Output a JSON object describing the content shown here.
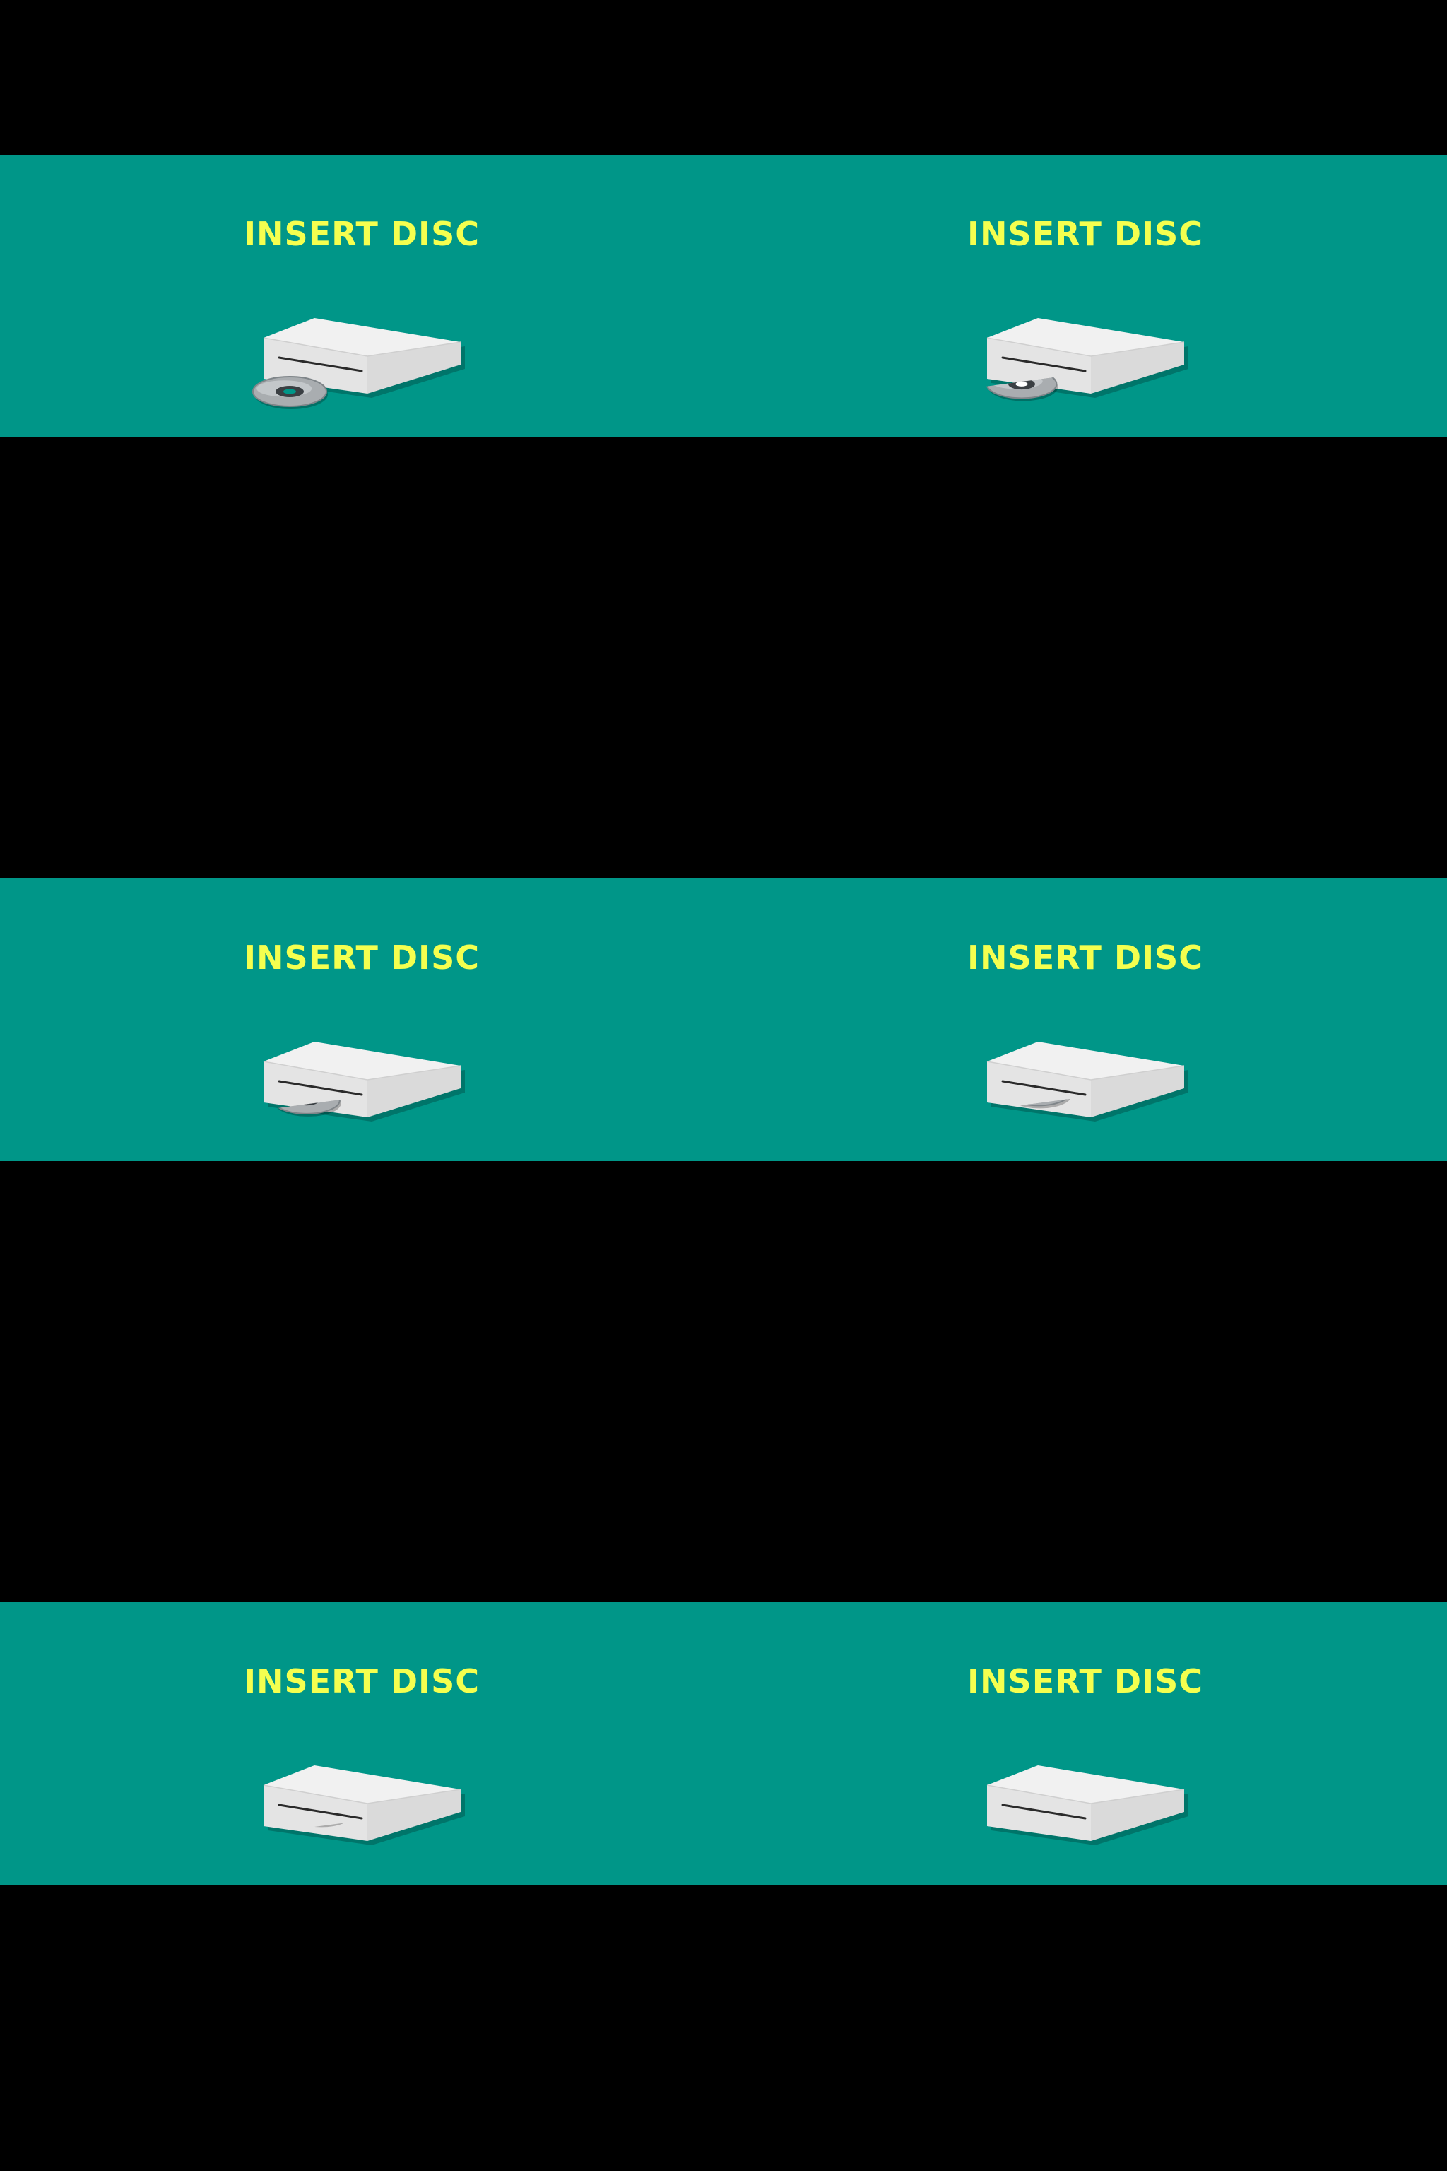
{
  "screen": {
    "background_color": "#000000",
    "band_color": "#009688",
    "title_color": "#f4ff4f"
  },
  "frames": [
    {
      "title": "INSERT DISC",
      "disc_inserted": 0.0
    },
    {
      "title": "INSERT DISC",
      "disc_inserted": 0.25
    },
    {
      "title": "INSERT DISC",
      "disc_inserted": 0.5
    },
    {
      "title": "INSERT DISC",
      "disc_inserted": 0.75
    },
    {
      "title": "INSERT DISC",
      "disc_inserted": 0.9
    },
    {
      "title": "INSERT DISC",
      "disc_inserted": 1.0
    }
  ],
  "icons": {
    "drive": "optical-drive-icon",
    "disc": "disc-icon"
  }
}
